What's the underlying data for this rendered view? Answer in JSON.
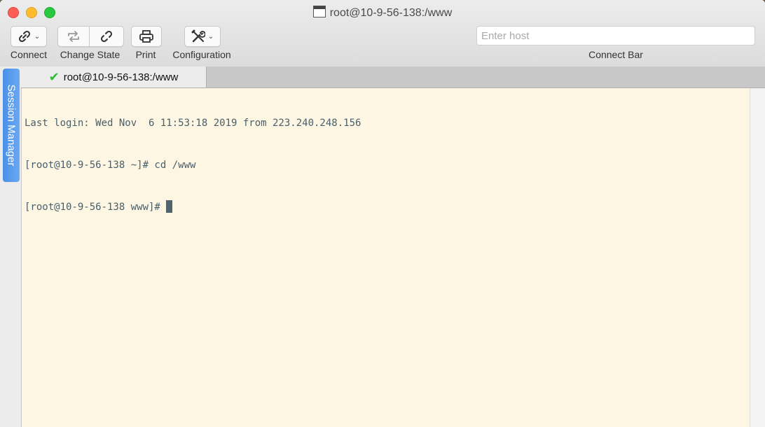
{
  "window": {
    "title": "root@10-9-56-138:/www"
  },
  "toolbar": {
    "connect_label": "Connect",
    "change_state_label": "Change State",
    "print_label": "Print",
    "configuration_label": "Configuration",
    "connect_bar_label": "Connect Bar",
    "host_placeholder": "Enter host",
    "host_value": ""
  },
  "tabs": [
    {
      "label": "root@10-9-56-138:/www",
      "status_icon": "check-icon",
      "active": true
    }
  ],
  "sidebar": {
    "session_manager_label": "Session Manager"
  },
  "terminal": {
    "lines": [
      "Last login: Wed Nov  6 11:53:18 2019 from 223.240.248.156",
      "[root@10-9-56-138 ~]# cd /www",
      "[root@10-9-56-138 www]# "
    ],
    "background": "#fdf6e3",
    "foreground": "#4a5f6a"
  },
  "colors": {
    "accent_blue": "#4a90e8",
    "status_green": "#2fbd3a"
  }
}
